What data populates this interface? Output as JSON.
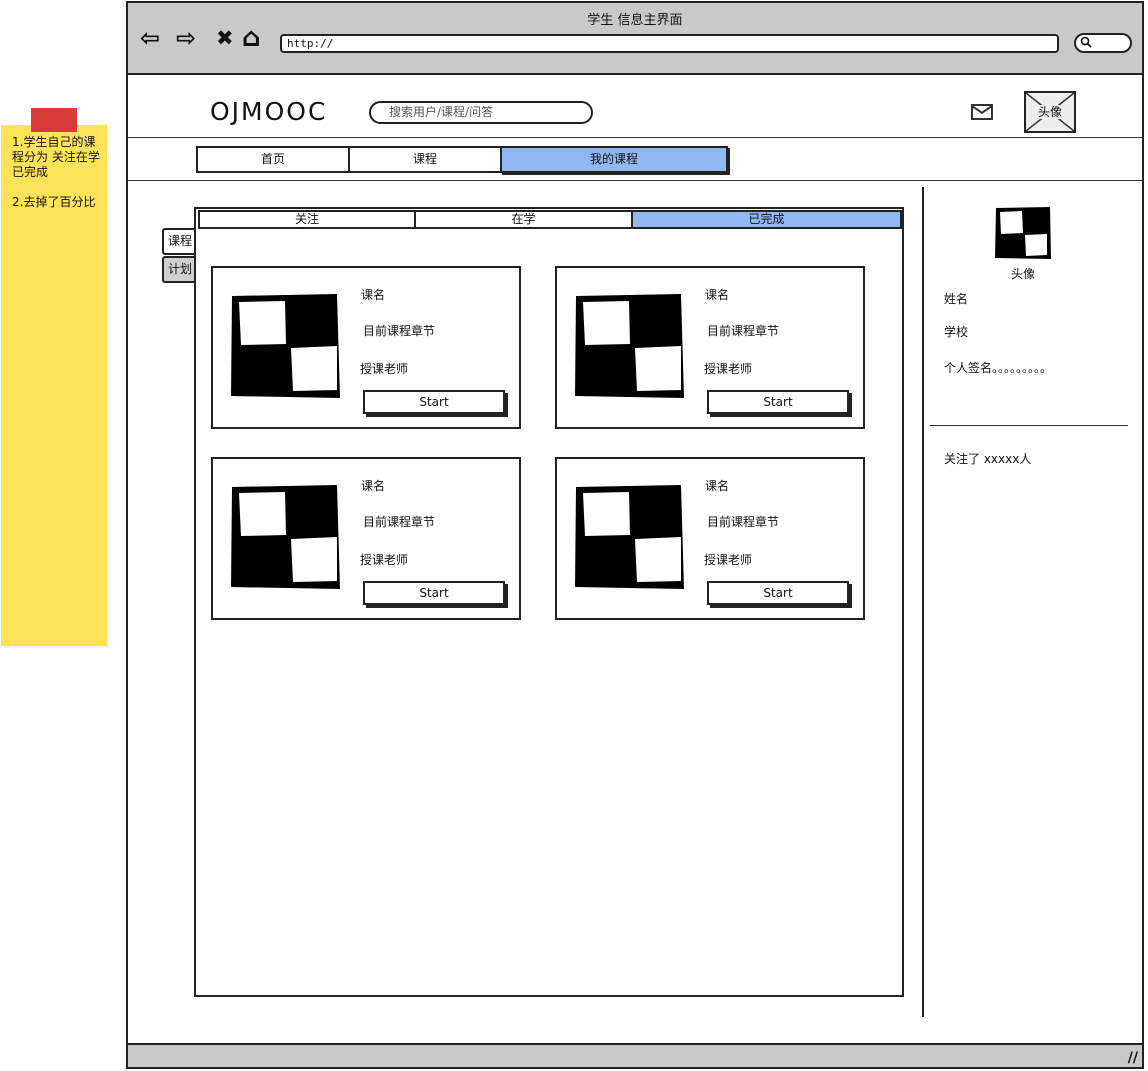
{
  "sticky_note": {
    "text": "1.学生自己的课程分为 关注在学 已完成\n\n2.去掉了百分比"
  },
  "browser": {
    "title": "学生 信息主界面",
    "url": "http://",
    "nav": {
      "back": "⇦",
      "forward": "⇨",
      "stop": "✖",
      "home": "⌂"
    },
    "search_icon": "🔍"
  },
  "header": {
    "logo": "OJMOOC",
    "search_placeholder": "搜索用户/课程/问答",
    "avatar_label": "头像"
  },
  "tabs": [
    {
      "label": "首页",
      "active": false
    },
    {
      "label": "课程",
      "active": false
    },
    {
      "label": "我的课程",
      "active": true
    }
  ],
  "side_tabs": [
    {
      "label": "课程",
      "active": true
    },
    {
      "label": "计划",
      "active": false
    }
  ],
  "sub_tabs": [
    {
      "label": "关注",
      "active": false
    },
    {
      "label": "在学",
      "active": false
    },
    {
      "label": "已完成",
      "active": true
    }
  ],
  "courses": [
    {
      "name": "课名",
      "chapter": "目前课程章节",
      "teacher": "授课老师",
      "button": "Start"
    },
    {
      "name": "课名",
      "chapter": "目前课程章节",
      "teacher": "授课老师",
      "button": "Start"
    },
    {
      "name": "课名",
      "chapter": "目前课程章节",
      "teacher": "授课老师",
      "button": "Start"
    },
    {
      "name": "课名",
      "chapter": "目前课程章节",
      "teacher": "授课老师",
      "button": "Start"
    }
  ],
  "profile": {
    "avatar_label": "头像",
    "name": "姓名",
    "school": "学校",
    "signature": "个人签名。。。。。。。。。",
    "following": "关注了 xxxxx人"
  },
  "colors": {
    "active_tab": "#91b8f2",
    "sticky": "#fde25a",
    "tape": "#d93b3b",
    "chrome": "#c9c9c9"
  }
}
